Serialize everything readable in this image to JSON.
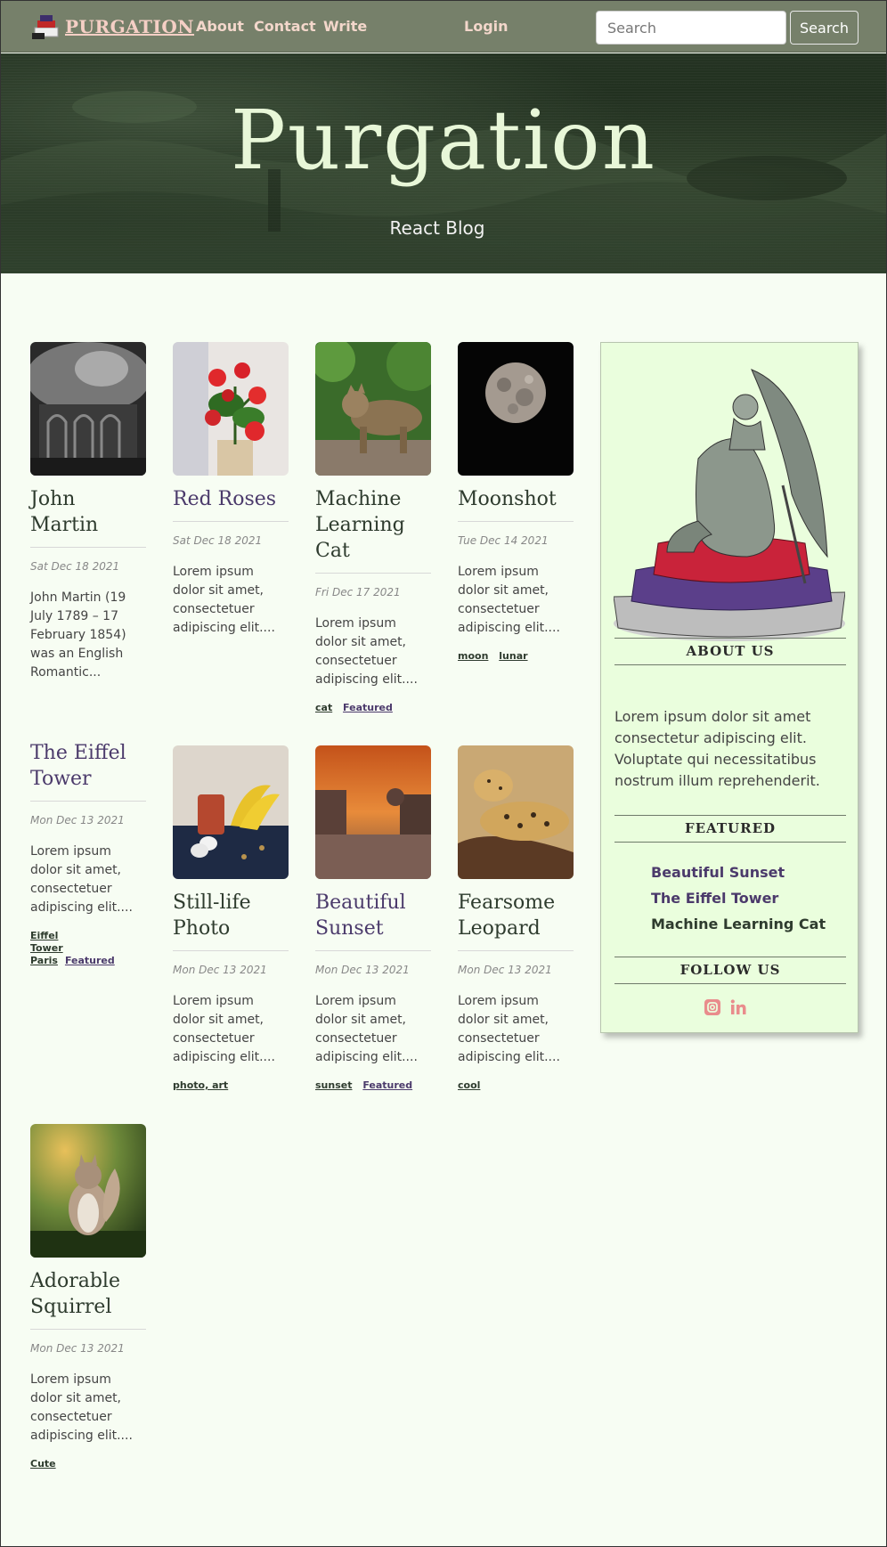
{
  "navbar": {
    "brand": "PURGATION",
    "links": [
      "About",
      "Contact",
      "Write",
      "Login"
    ],
    "search_placeholder": "Search",
    "search_button": "Search"
  },
  "hero": {
    "title": "Purgation",
    "subtitle": "React Blog"
  },
  "posts": [
    {
      "title": "John Martin",
      "date": "Sat Dec 18 2021",
      "desc": "John Martin (19 July 1789 – 17 February 1854) was an English Romantic...",
      "tags": []
    },
    {
      "title": "Red Roses",
      "date": "Sat Dec 18 2021",
      "desc": "Lorem ipsum dolor sit amet, consectetuer adipiscing elit....",
      "tags": []
    },
    {
      "title": "Machine Learning Cat",
      "date": "Fri Dec 17 2021",
      "desc": "Lorem ipsum dolor sit amet, consectetuer adipiscing elit....",
      "tags": [
        "cat",
        "Featured"
      ]
    },
    {
      "title": "Moonshot",
      "date": "Tue Dec 14 2021",
      "desc": "Lorem ipsum dolor sit amet, consectetuer adipiscing elit....",
      "tags": [
        "moon",
        "lunar"
      ]
    },
    {
      "title": "The Eiffel Tower",
      "date": "Mon Dec 13 2021",
      "desc": "Lorem ipsum dolor sit amet, consectetuer adipiscing elit....",
      "tags": [
        "Eiffel Tower",
        "Paris",
        "Featured"
      ]
    },
    {
      "title": "Still-life Photo",
      "date": "Mon Dec 13 2021",
      "desc": "Lorem ipsum dolor sit amet, consectetuer adipiscing elit....",
      "tags": [
        "photo, art"
      ]
    },
    {
      "title": "Beautiful Sunset",
      "date": "Mon Dec 13 2021",
      "desc": "Lorem ipsum dolor sit amet, consectetuer adipiscing elit....",
      "tags": [
        "sunset",
        "Featured"
      ]
    },
    {
      "title": "Fearsome Leopard",
      "date": "Mon Dec 13 2021",
      "desc": "Lorem ipsum dolor sit amet, consectetuer adipiscing elit....",
      "tags": [
        "cool"
      ]
    },
    {
      "title": "Adorable Squirrel",
      "date": "Mon Dec 13 2021",
      "desc": "Lorem ipsum dolor sit amet, consectetuer adipiscing elit....",
      "tags": [
        "Cute"
      ]
    }
  ],
  "sidebar": {
    "about_heading": "ABOUT US",
    "about_text": "Lorem ipsum dolor sit amet consectetur adipiscing elit. Voluptate qui necessitatibus nostrum illum reprehenderit.",
    "featured_heading": "FEATURED",
    "featured": [
      "Beautiful Sunset",
      "The Eiffel Tower",
      "Machine Learning Cat"
    ],
    "follow_heading": "FOLLOW US",
    "social_icons": [
      "instagram-icon",
      "linkedin-icon"
    ]
  },
  "colors": {
    "navbar_bg": "#76806a",
    "nav_link": "#f3d7cb",
    "hero_title": "#e8f7d8",
    "purple_accent": "#4b3a6b",
    "dark_green_text": "#2e3b2e",
    "sidebar_bg": "#eafedd",
    "social_icon": "#e98c8c"
  }
}
